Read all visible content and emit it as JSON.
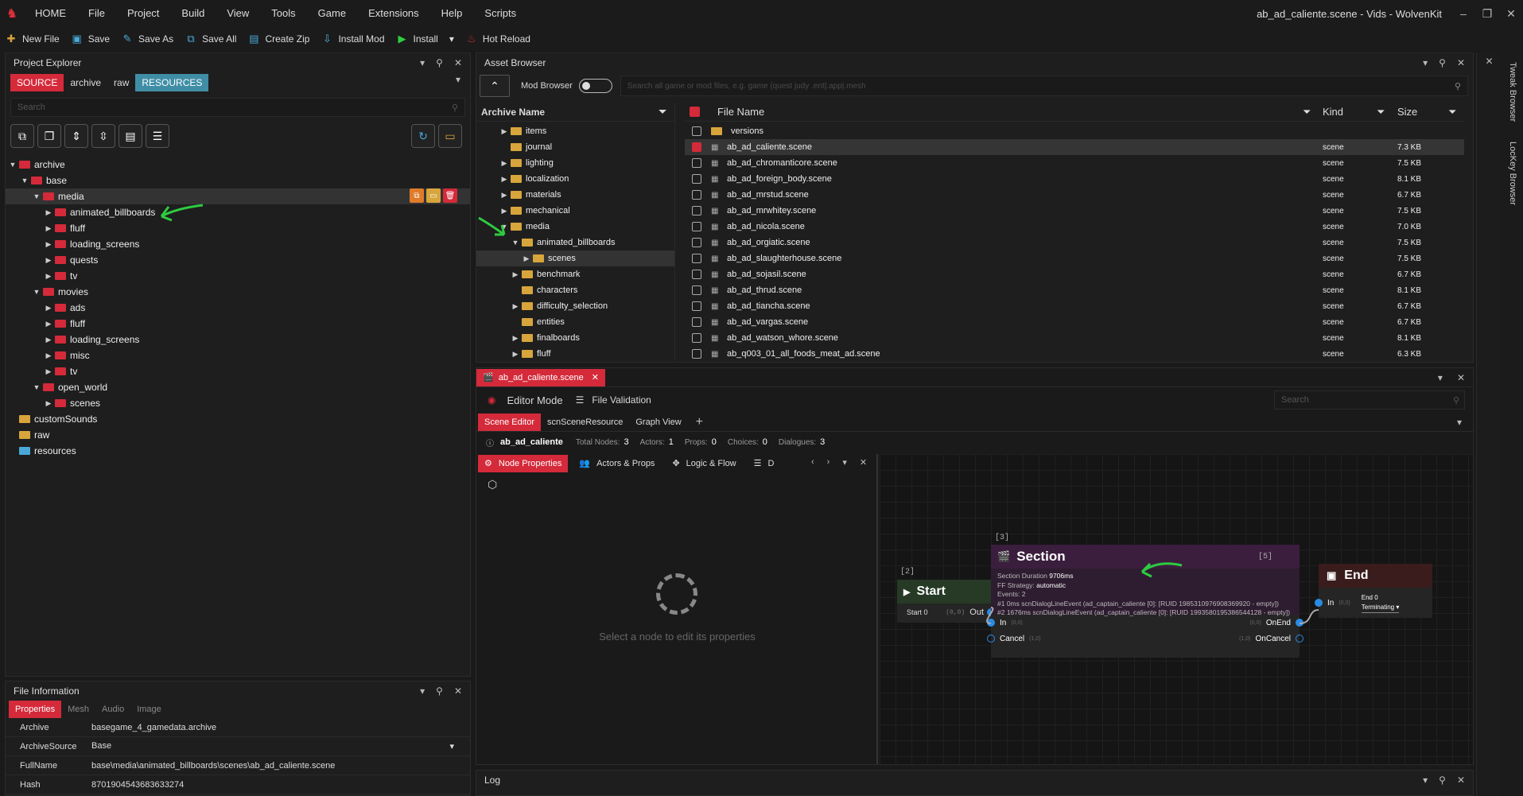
{
  "menu": {
    "items": [
      "HOME",
      "File",
      "Project",
      "Build",
      "View",
      "Tools",
      "Game",
      "Extensions",
      "Help",
      "Scripts"
    ],
    "window_title": "ab_ad_caliente.scene - Vids - WolvenKit"
  },
  "toolbar": {
    "new_file": "New File",
    "save": "Save",
    "save_as": "Save As",
    "save_all": "Save All",
    "create_zip": "Create Zip",
    "install_mod": "Install Mod",
    "install": "Install",
    "hot_reload": "Hot Reload"
  },
  "project_explorer": {
    "title": "Project Explorer",
    "tabs": [
      "SOURCE",
      "archive",
      "raw",
      "RESOURCES"
    ],
    "search_placeholder": "Search",
    "tree": [
      {
        "label": "archive",
        "depth": 0,
        "caret": "▼",
        "color": "red"
      },
      {
        "label": "base",
        "depth": 1,
        "caret": "▼",
        "color": "red"
      },
      {
        "label": "media",
        "depth": 2,
        "caret": "▼",
        "color": "red",
        "selected": true
      },
      {
        "label": "animated_billboards",
        "depth": 3,
        "caret": "▶",
        "color": "red"
      },
      {
        "label": "fluff",
        "depth": 3,
        "caret": "▶",
        "color": "red"
      },
      {
        "label": "loading_screens",
        "depth": 3,
        "caret": "▶",
        "color": "red"
      },
      {
        "label": "quests",
        "depth": 3,
        "caret": "▶",
        "color": "red"
      },
      {
        "label": "tv",
        "depth": 3,
        "caret": "▶",
        "color": "red"
      },
      {
        "label": "movies",
        "depth": 2,
        "caret": "▼",
        "color": "red"
      },
      {
        "label": "ads",
        "depth": 3,
        "caret": "▶",
        "color": "red"
      },
      {
        "label": "fluff",
        "depth": 3,
        "caret": "▶",
        "color": "red"
      },
      {
        "label": "loading_screens",
        "depth": 3,
        "caret": "▶",
        "color": "red"
      },
      {
        "label": "misc",
        "depth": 3,
        "caret": "▶",
        "color": "red"
      },
      {
        "label": "tv",
        "depth": 3,
        "caret": "▶",
        "color": "red"
      },
      {
        "label": "open_world",
        "depth": 2,
        "caret": "▼",
        "color": "red"
      },
      {
        "label": "scenes",
        "depth": 3,
        "caret": "▶",
        "color": "red"
      },
      {
        "label": "customSounds",
        "depth": 0,
        "caret": "",
        "color": "yellow"
      },
      {
        "label": "raw",
        "depth": 0,
        "caret": "",
        "color": "yellow"
      },
      {
        "label": "resources",
        "depth": 0,
        "caret": "",
        "color": "blue"
      }
    ]
  },
  "file_info": {
    "title": "File Information",
    "tabs": [
      "Properties",
      "Mesh",
      "Audio",
      "Image"
    ],
    "rows": [
      {
        "key": "Archive",
        "value": "basegame_4_gamedata.archive"
      },
      {
        "key": "ArchiveSource",
        "value": "Base"
      },
      {
        "key": "FullName",
        "value": "base\\media\\animated_billboards\\scenes\\ab_ad_caliente.scene"
      },
      {
        "key": "Hash",
        "value": "8701904543683633274"
      }
    ]
  },
  "asset_browser": {
    "title": "Asset Browser",
    "mod_browser_label": "Mod Browser",
    "search_placeholder": "Search all game or mod files, e.g. game (quest judy .ent|.app|.mesh",
    "archive_header": "Archive Name",
    "archive_tree": [
      {
        "label": "items",
        "depth": 0,
        "caret": "▶"
      },
      {
        "label": "journal",
        "depth": 0,
        "caret": ""
      },
      {
        "label": "lighting",
        "depth": 0,
        "caret": "▶"
      },
      {
        "label": "localization",
        "depth": 0,
        "caret": "▶"
      },
      {
        "label": "materials",
        "depth": 0,
        "caret": "▶"
      },
      {
        "label": "mechanical",
        "depth": 0,
        "caret": "▶"
      },
      {
        "label": "media",
        "depth": 0,
        "caret": "▼"
      },
      {
        "label": "animated_billboards",
        "depth": 1,
        "caret": "▼"
      },
      {
        "label": "scenes",
        "depth": 2,
        "caret": "▶",
        "selected": true
      },
      {
        "label": "benchmark",
        "depth": 1,
        "caret": "▶"
      },
      {
        "label": "characters",
        "depth": 1,
        "caret": ""
      },
      {
        "label": "difficulty_selection",
        "depth": 1,
        "caret": "▶"
      },
      {
        "label": "entities",
        "depth": 1,
        "caret": ""
      },
      {
        "label": "finalboards",
        "depth": 1,
        "caret": "▶"
      },
      {
        "label": "fluff",
        "depth": 1,
        "caret": "▶"
      }
    ],
    "columns": {
      "name": "File Name",
      "kind": "Kind",
      "size": "Size"
    },
    "files": [
      {
        "name": "versions",
        "kind": "",
        "size": "",
        "folder": true
      },
      {
        "name": "ab_ad_caliente.scene",
        "kind": "scene",
        "size": "7.3 KB",
        "selected": true
      },
      {
        "name": "ab_ad_chromanticore.scene",
        "kind": "scene",
        "size": "7.5 KB"
      },
      {
        "name": "ab_ad_foreign_body.scene",
        "kind": "scene",
        "size": "8.1 KB"
      },
      {
        "name": "ab_ad_mrstud.scene",
        "kind": "scene",
        "size": "6.7 KB"
      },
      {
        "name": "ab_ad_mrwhitey.scene",
        "kind": "scene",
        "size": "7.5 KB"
      },
      {
        "name": "ab_ad_nicola.scene",
        "kind": "scene",
        "size": "7.0 KB"
      },
      {
        "name": "ab_ad_orgiatic.scene",
        "kind": "scene",
        "size": "7.5 KB"
      },
      {
        "name": "ab_ad_slaughterhouse.scene",
        "kind": "scene",
        "size": "7.5 KB"
      },
      {
        "name": "ab_ad_sojasil.scene",
        "kind": "scene",
        "size": "6.7 KB"
      },
      {
        "name": "ab_ad_thrud.scene",
        "kind": "scene",
        "size": "8.1 KB"
      },
      {
        "name": "ab_ad_tiancha.scene",
        "kind": "scene",
        "size": "6.7 KB"
      },
      {
        "name": "ab_ad_vargas.scene",
        "kind": "scene",
        "size": "6.7 KB"
      },
      {
        "name": "ab_ad_watson_whore.scene",
        "kind": "scene",
        "size": "8.1 KB"
      },
      {
        "name": "ab_q003_01_all_foods_meat_ad.scene",
        "kind": "scene",
        "size": "6.3 KB"
      }
    ]
  },
  "editor": {
    "doc_tab": "ab_ad_caliente.scene",
    "editor_mode": "Editor Mode",
    "file_validation": "File Validation",
    "search_placeholder": "Search",
    "subtabs": [
      "Scene Editor",
      "scnSceneResource",
      "Graph View"
    ],
    "scene_name": "ab_ad_caliente",
    "stats": [
      {
        "label": "Total Nodes:",
        "value": "3"
      },
      {
        "label": "Actors:",
        "value": "1"
      },
      {
        "label": "Props:",
        "value": "0"
      },
      {
        "label": "Choices:",
        "value": "0"
      },
      {
        "label": "Dialogues:",
        "value": "3"
      }
    ],
    "prop_tabs": [
      "Node Properties",
      "Actors & Props",
      "Logic & Flow",
      "D"
    ],
    "empty_hint": "Select a node to edit its properties",
    "nodes": {
      "start": {
        "id": "[2]",
        "title": "Start",
        "port_label": "Start 0",
        "coord": "(0,0)",
        "out": "Out"
      },
      "section": {
        "id": "[3]",
        "title": "Section",
        "duration_label": "Section Duration",
        "duration": "9706ms",
        "strategy_label": "FF Strategy:",
        "strategy": "automatic",
        "events": "Events: 2",
        "event1": "#1 0ms  scnDialogLineEvent (ad_captain_caliente [0]: [RUID 1985310976908369920 - empty])",
        "event2": "#2 1676ms  scnDialogLineEvent (ad_captain_caliente [0]: [RUID 1993580195386544128 - empty])",
        "in": "In",
        "in_coord": "(0,0)",
        "cancel": "Cancel",
        "cancel_coord": "(1,0)",
        "onend": "OnEnd",
        "onend_coord": "(0,0)",
        "oncancel": "OnCancel",
        "oncancel_coord": "(1,0)"
      },
      "end": {
        "id": "[5]",
        "title": "End",
        "in": "In",
        "in_coord": "(0,0)",
        "end_label": "End 0",
        "mode": "Terminating"
      }
    }
  },
  "log": {
    "title": "Log"
  },
  "sidebar": {
    "tabs": [
      "Tweak Browser",
      "LocKey Browser"
    ]
  },
  "colors": {
    "accent": "#d42a3a",
    "teal": "#3f8ea6",
    "annotation": "#2ecc40"
  }
}
